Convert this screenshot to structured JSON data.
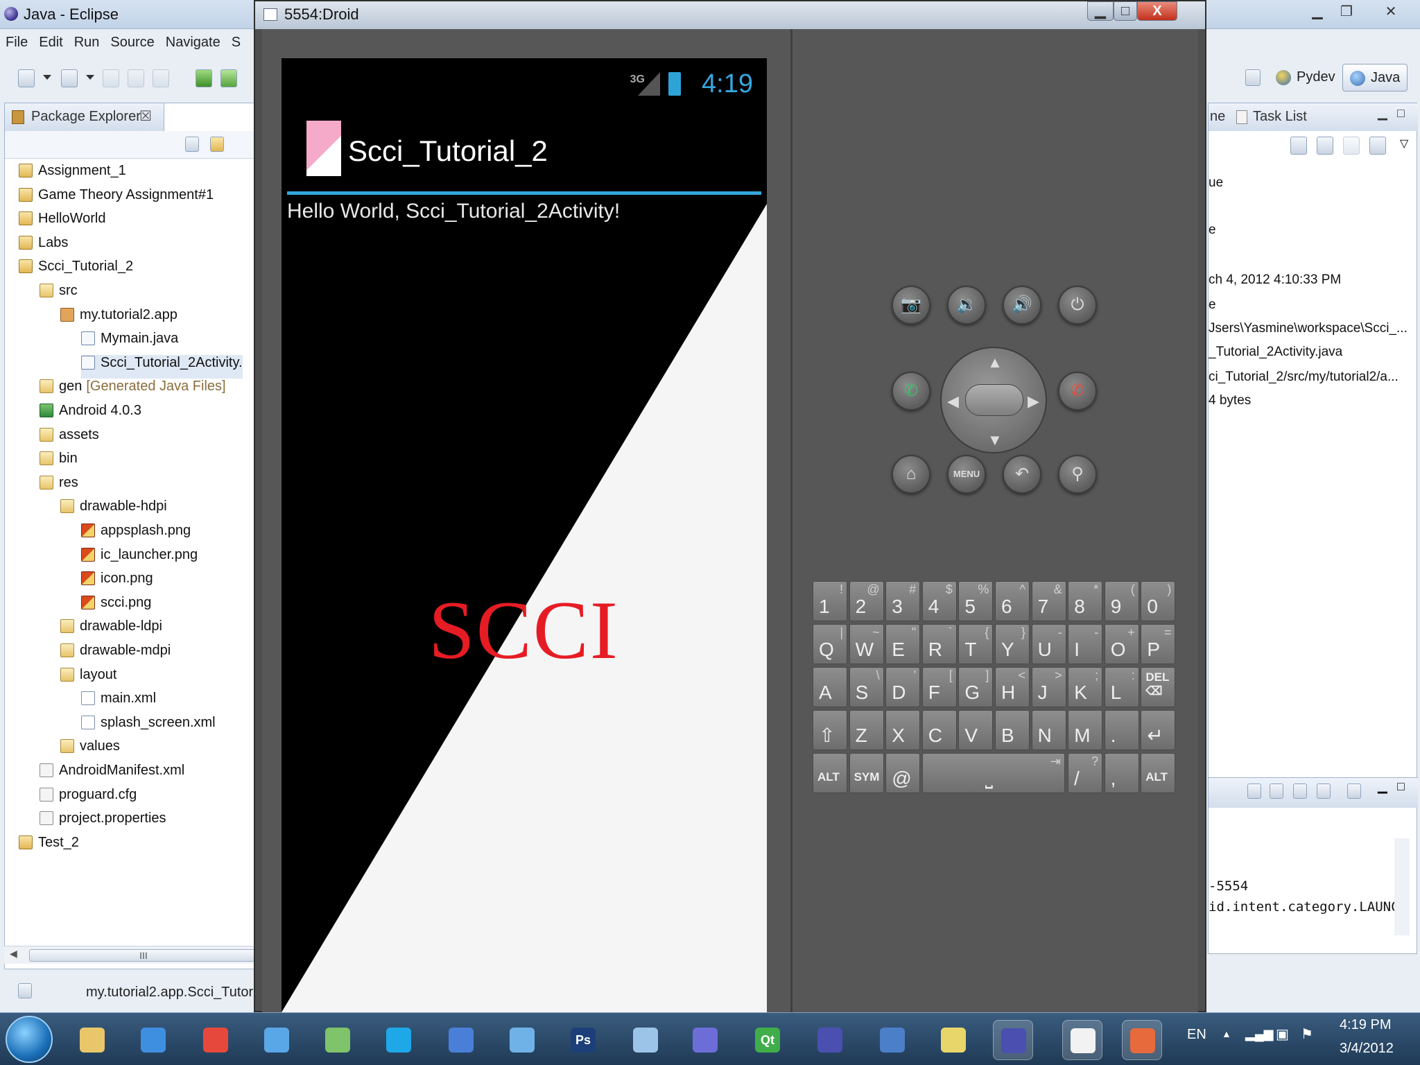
{
  "eclipse": {
    "title": "Java - Eclipse",
    "menu": [
      "File",
      "Edit",
      "Run",
      "Source",
      "Navigate",
      "S"
    ],
    "package_explorer": {
      "tab_label": "Package Explorer",
      "close_glyph": "☒",
      "tree": [
        {
          "label": "Assignment_1",
          "icon": "project-icon"
        },
        {
          "label": "Game Theory Assignment#1",
          "icon": "project-icon"
        },
        {
          "label": "HelloWorld",
          "icon": "project-icon"
        },
        {
          "label": "Labs",
          "icon": "project-icon"
        },
        {
          "label": "Scci_Tutorial_2",
          "icon": "project-icon"
        },
        {
          "label": "src",
          "icon": "folder-icon"
        },
        {
          "label": "my.tutorial2.app",
          "icon": "package-icon"
        },
        {
          "label": "Mymain.java",
          "icon": "java-file-icon"
        },
        {
          "label": "Scci_Tutorial_2Activity.",
          "icon": "java-file-icon"
        },
        {
          "label": "gen",
          "annotation": "[Generated Java Files]",
          "icon": "folder-icon"
        },
        {
          "label": "Android 4.0.3",
          "icon": "library-icon"
        },
        {
          "label": "assets",
          "icon": "folder-icon"
        },
        {
          "label": "bin",
          "icon": "folder-icon"
        },
        {
          "label": "res",
          "icon": "folder-icon"
        },
        {
          "label": "drawable-hdpi",
          "icon": "folder-icon"
        },
        {
          "label": "appsplash.png",
          "icon": "image-file-icon"
        },
        {
          "label": "ic_launcher.png",
          "icon": "image-file-icon"
        },
        {
          "label": "icon.png",
          "icon": "image-file-icon"
        },
        {
          "label": "scci.png",
          "icon": "image-file-icon"
        },
        {
          "label": "drawable-ldpi",
          "icon": "folder-icon"
        },
        {
          "label": "drawable-mdpi",
          "icon": "folder-icon"
        },
        {
          "label": "layout",
          "icon": "folder-icon"
        },
        {
          "label": "main.xml",
          "icon": "xml-file-icon"
        },
        {
          "label": "splash_screen.xml",
          "icon": "xml-file-icon"
        },
        {
          "label": "values",
          "icon": "folder-icon"
        },
        {
          "label": "AndroidManifest.xml",
          "icon": "manifest-file-icon"
        },
        {
          "label": "proguard.cfg",
          "icon": "text-file-icon"
        },
        {
          "label": "project.properties",
          "icon": "text-file-icon"
        },
        {
          "label": "Test_2",
          "icon": "project-icon"
        }
      ],
      "scroll_thumb": "III"
    },
    "status_text": "my.tutorial2.app.Scci_Tutori",
    "perspectives": {
      "pydev": "Pydev",
      "java": "Java"
    },
    "right_panel": {
      "tab_partial": "ne",
      "task_list": "Task List",
      "props": [
        "ue",
        "e",
        "ch 4, 2012 4:10:33 PM",
        "e",
        "Jsers\\Yasmine\\workspace\\Scci_...",
        "_Tutorial_2Activity.java",
        "ci_Tutorial_2/src/my/tutorial2/a...",
        "4  bytes"
      ],
      "console": [
        "-5554",
        "id.intent.category.LAUNC"
      ]
    }
  },
  "emulator": {
    "title": "5554:Droid",
    "controls": {
      "minimize": "▁",
      "maximize": "□",
      "close": "X"
    },
    "phone": {
      "network": "3G",
      "time": "4:19",
      "app_name": "Scci_Tutorial_2",
      "hello_text": "Hello World, Scci_Tutorial_2Activity!",
      "splash_logo": "SCCI",
      "colors": {
        "accent": "#33a7d9",
        "logo": "#e61c24"
      }
    },
    "buttons": {
      "camera": "📷",
      "volume_down": "🔉",
      "volume_up": "🔊",
      "power": "⏻",
      "call": "✆",
      "end_call": "✆",
      "home": "⌂",
      "menu": "MENU",
      "back": "↶",
      "search": "⚲"
    },
    "dpad": {
      "up": "▲",
      "down": "▼",
      "left": "◀",
      "right": "▶"
    },
    "keyboard": {
      "rows": [
        [
          {
            "main": "1",
            "alt": "!"
          },
          {
            "main": "2",
            "alt": "@"
          },
          {
            "main": "3",
            "alt": "#"
          },
          {
            "main": "4",
            "alt": "$"
          },
          {
            "main": "5",
            "alt": "%"
          },
          {
            "main": "6",
            "alt": "^"
          },
          {
            "main": "7",
            "alt": "&"
          },
          {
            "main": "8",
            "alt": "*"
          },
          {
            "main": "9",
            "alt": "("
          },
          {
            "main": "0",
            "alt": ")"
          }
        ],
        [
          {
            "main": "Q",
            "alt": "|"
          },
          {
            "main": "W",
            "alt": "~"
          },
          {
            "main": "E",
            "alt": "\""
          },
          {
            "main": "R",
            "alt": "`"
          },
          {
            "main": "T",
            "alt": "{"
          },
          {
            "main": "Y",
            "alt": "}"
          },
          {
            "main": "U",
            "alt": "-"
          },
          {
            "main": "I",
            "alt": "-"
          },
          {
            "main": "O",
            "alt": "+"
          },
          {
            "main": "P",
            "alt": "="
          }
        ],
        [
          {
            "main": "A",
            "alt": ""
          },
          {
            "main": "S",
            "alt": "\\"
          },
          {
            "main": "D",
            "alt": "'"
          },
          {
            "main": "F",
            "alt": "["
          },
          {
            "main": "G",
            "alt": "]"
          },
          {
            "main": "H",
            "alt": "<"
          },
          {
            "main": "J",
            "alt": ">"
          },
          {
            "main": "K",
            "alt": ";"
          },
          {
            "main": "L",
            "alt": ":"
          },
          {
            "main": "DEL ⌫",
            "alt": ""
          }
        ],
        [
          {
            "main": "⇧",
            "alt": ""
          },
          {
            "main": "Z",
            "alt": ""
          },
          {
            "main": "X",
            "alt": ""
          },
          {
            "main": "C",
            "alt": ""
          },
          {
            "main": "V",
            "alt": ""
          },
          {
            "main": "B",
            "alt": ""
          },
          {
            "main": "N",
            "alt": ""
          },
          {
            "main": "M",
            "alt": ""
          },
          {
            "main": ".",
            "alt": ""
          },
          {
            "main": "↵",
            "alt": ""
          }
        ]
      ],
      "bottom": {
        "alt_left": "ALT",
        "sym": "SYM",
        "at": "@",
        "space": "⎵",
        "tab": "⇥",
        "slash": "/",
        "question": "?",
        "comma": ",",
        "alt_right": "ALT"
      }
    }
  },
  "taskbar": {
    "apps": [
      "windows-explorer-icon",
      "internet-explorer-icon",
      "chrome-icon",
      "safari-icon",
      "people-icon",
      "skype-icon",
      "itunes-icon",
      "chat-icon",
      "photoshop-icon",
      "image-viewer-icon",
      "infinity-icon",
      "qt-icon",
      "eclipse-icon",
      "building-icon",
      "folder-app-icon",
      "eclipse-active-icon",
      "notepad-icon",
      "office-icon"
    ],
    "ps_label": "Ps",
    "qt_label": "Qt",
    "lang": "EN",
    "time": "4:19 PM",
    "date": "3/4/2012"
  }
}
